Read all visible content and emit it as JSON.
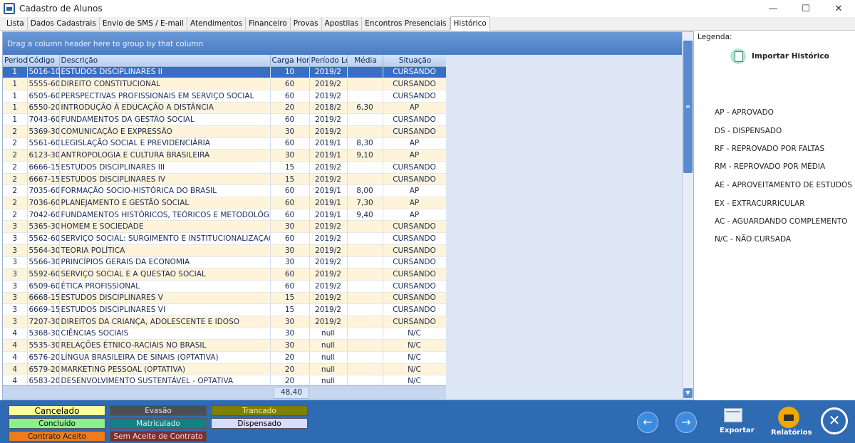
{
  "window": {
    "title": "Cadastro de Alunos",
    "minimize": "—",
    "maximize": "☐",
    "close": "✕"
  },
  "tabs": [
    "Lista",
    "Dados Cadastrais",
    "Envio de SMS / E-mail",
    "Atendimentos",
    "Financeiro",
    "Provas",
    "Apostilas",
    "Encontros Presenciais",
    "Histórico"
  ],
  "active_tab": "Histórico",
  "grid": {
    "group_hint": "Drag a column header here to group by that column",
    "columns": [
      "Period",
      "Código",
      "Descrição",
      "Carga Hora",
      "Período Let",
      "Média",
      "Situação"
    ],
    "rows": [
      [
        "1",
        "5016-10",
        "ESTUDOS DISCIPLINARES II",
        "10",
        "2019/2",
        "",
        "CURSANDO"
      ],
      [
        "1",
        "5555-60",
        "DIREITO CONSTITUCIONAL",
        "60",
        "2019/2",
        "",
        "CURSANDO"
      ],
      [
        "1",
        "6505-60",
        "PERSPECTIVAS PROFISSIONAIS EM SERVIÇO SOCIAL",
        "60",
        "2019/2",
        "",
        "CURSANDO"
      ],
      [
        "1",
        "6550-20",
        "INTRODUÇÃO À EDUCAÇÃO A DISTÂNCIA",
        "20",
        "2018/2",
        "6,30",
        "AP"
      ],
      [
        "1",
        "7043-60",
        "FUNDAMENTOS DA GESTÃO SOCIAL",
        "60",
        "2019/2",
        "",
        "CURSANDO"
      ],
      [
        "2",
        "5369-30",
        "COMUNICAÇÃO E EXPRESSÃO",
        "30",
        "2019/2",
        "",
        "CURSANDO"
      ],
      [
        "2",
        "5561-60",
        "LEGISLAÇÃO SOCIAL E PREVIDENCIÁRIA",
        "60",
        "2019/1",
        "8,30",
        "AP"
      ],
      [
        "2",
        "6123-30",
        "ANTROPOLOGIA E CULTURA BRASILEIRA",
        "30",
        "2019/1",
        "9,10",
        "AP"
      ],
      [
        "2",
        "6666-15",
        "ESTUDOS DISCIPLINARES III",
        "15",
        "2019/2",
        "",
        "CURSANDO"
      ],
      [
        "2",
        "6667-15",
        "ESTUDOS DISCIPLINARES IV",
        "15",
        "2019/2",
        "",
        "CURSANDO"
      ],
      [
        "2",
        "7035-60",
        "FORMAÇÃO SOCIO-HISTÓRICA DO BRASIL",
        "60",
        "2019/1",
        "8,00",
        "AP"
      ],
      [
        "2",
        "7036-60",
        "PLANEJAMENTO E GESTÃO SOCIAL",
        "60",
        "2019/1",
        "7,30",
        "AP"
      ],
      [
        "2",
        "7042-60",
        "FUNDAMENTOS HISTÓRICOS, TEÓRICOS E METODOLÓGICOS",
        "60",
        "2019/1",
        "9,40",
        "AP"
      ],
      [
        "3",
        "5365-30",
        "HOMEM E SOCIEDADE",
        "30",
        "2019/2",
        "",
        "CURSANDO"
      ],
      [
        "3",
        "5562-60",
        "SERVIÇO SOCIAL: SURGIMENTO E INSTITUCIONALIZAÇAO NO",
        "60",
        "2019/2",
        "",
        "CURSANDO"
      ],
      [
        "3",
        "5564-30",
        "TEORIA POLÍTICA",
        "30",
        "2019/2",
        "",
        "CURSANDO"
      ],
      [
        "3",
        "5566-30",
        "PRINCÍPIOS GERAIS DA ECONOMIA",
        "30",
        "2019/2",
        "",
        "CURSANDO"
      ],
      [
        "3",
        "5592-60",
        "SERVIÇO SOCIAL E A QUESTAO SOCIAL",
        "60",
        "2019/2",
        "",
        "CURSANDO"
      ],
      [
        "3",
        "6509-60",
        "ÉTICA PROFISSIONAL",
        "60",
        "2019/2",
        "",
        "CURSANDO"
      ],
      [
        "3",
        "6668-15",
        "ESTUDOS DISCIPLINARES V",
        "15",
        "2019/2",
        "",
        "CURSANDO"
      ],
      [
        "3",
        "6669-15",
        "ESTUDOS DISCIPLINARES VI",
        "15",
        "2019/2",
        "",
        "CURSANDO"
      ],
      [
        "3",
        "7207-30",
        "DIREITOS DA CRIANÇA, ADOLESCENTE E IDOSO",
        "30",
        "2019/2",
        "",
        "CURSANDO"
      ],
      [
        "4",
        "5368-30",
        "CIÊNCIAS SOCIAIS",
        "30",
        "null",
        "",
        "N/C"
      ],
      [
        "4",
        "5535-30",
        "RELAÇÕES ÉTNICO-RACIAIS NO BRASIL",
        "30",
        "null",
        "",
        "N/C"
      ],
      [
        "4",
        "6576-20",
        "LÍNGUA BRASILEIRA DE SINAIS (OPTATIVA)",
        "20",
        "null",
        "",
        "N/C"
      ],
      [
        "4",
        "6579-20",
        "MARKETING PESSOAL  (OPTATIVA)",
        "20",
        "null",
        "",
        "N/C"
      ],
      [
        "4",
        "6583-20",
        "DESENVOLVIMENTO SUSTENTÁVEL - OPTATIVA",
        "20",
        "null",
        "",
        "N/C"
      ]
    ],
    "selected_row": 0,
    "footer_total": "48,40"
  },
  "legend": {
    "title": "Legenda:",
    "import_label": "Importar Histórico",
    "items": [
      "AP - APROVADO",
      "DS - DISPENSADO",
      "RF - REPROVADO POR FALTAS",
      "RM - REPROVADO POR MÉDIA",
      "AE - APROVEITAMENTO DE ESTUDOS",
      "EX - EXTRACURRICULAR",
      "AC - AGUARDANDO COMPLEMENTO",
      "N/C - NÃO CURSADA"
    ]
  },
  "status_chips": [
    {
      "label": "Cancelado",
      "bg": "#ffff99",
      "fg": "#000000"
    },
    {
      "label": "Evasão",
      "bg": "#4a4f55",
      "fg": "#e0e0e0"
    },
    {
      "label": "Trancado",
      "bg": "#808000",
      "fg": "#f0f0a0"
    },
    {
      "label": "Concluído",
      "bg": "#8cf08c",
      "fg": "#000000"
    },
    {
      "label": "Matriculado",
      "bg": "#11808a",
      "fg": "#e0f0f0"
    },
    {
      "label": "Dispensado",
      "bg": "#d8dcff",
      "fg": "#000000"
    },
    {
      "label": "Contrato Aceito",
      "bg": "#f07b1a",
      "fg": "#1a1a1a"
    },
    {
      "label": "Sem Aceite de Contrato",
      "bg": "#7a3030",
      "fg": "#ffd8d8"
    }
  ],
  "actions": {
    "prev": "←",
    "next": "→",
    "export_label": "Exportar",
    "reports_label": "Relatórios",
    "close": "✕"
  }
}
